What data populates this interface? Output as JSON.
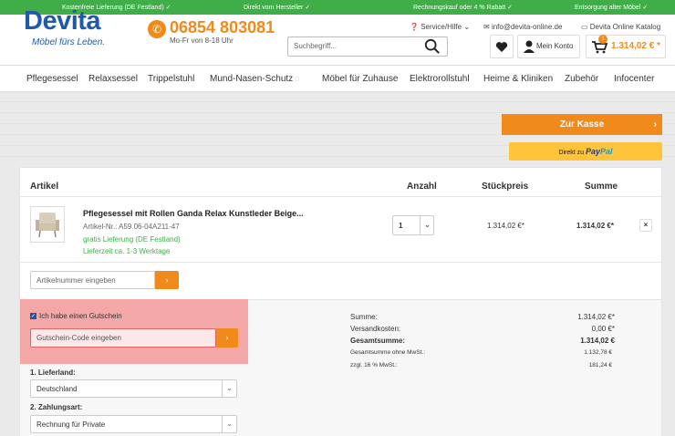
{
  "topbar": {
    "items": [
      "Kostenfreie Lieferung (DE Festland) ✓",
      "Direkt vom Hersteller ✓",
      "Rechnungskauf oder 4 % Rabatt ✓",
      "Entsorgung alter Möbel ✓"
    ]
  },
  "header": {
    "logo": "Devita",
    "tagline": "Möbel fürs Leben.",
    "phone": "06854 803081",
    "phone_hours": "Mo-Fr von 8-18 Uhr",
    "search_placeholder": "Suchbegriff...",
    "service": "Service/Hilfe",
    "email": "info@devita-online.de",
    "catalog": "Devita Online Katalog",
    "account": "Mein Konto",
    "cart_count": "1",
    "cart_amount": "1.314,02 € *"
  },
  "nav": {
    "items": [
      "Pflegesessel",
      "Relaxsessel",
      "Trippelstuhl",
      "Mund-Nasen-Schutz",
      "Möbel für Zuhause",
      "Elektrorollstuhl",
      "Heime & Kliniken",
      "Zubehör",
      "Infocenter"
    ]
  },
  "checkout": {
    "kasse_label": "Zur Kasse",
    "paypal_prefix": "Direkt zu",
    "paypal_brand_a": "Pay",
    "paypal_brand_b": "Pal"
  },
  "table": {
    "headers": {
      "article": "Artikel",
      "qty": "Anzahl",
      "unit": "Stückpreis",
      "total": "Summe"
    },
    "item": {
      "name": "Pflegesessel mit Rollen Ganda Relax Kunstleder Beige...",
      "artnr": "Artikel-Nr.: A59.06-04A211-47",
      "shipping": "gratis Lieferung (DE Festland)",
      "delivery": "Lieferzeit ca. 1-3 Werktage",
      "qty": "1",
      "unit_price": "1.314,02 €*",
      "total_price": "1.314,02 €*",
      "remove": "×"
    },
    "artnr_placeholder": "Artikelnummer eingeben"
  },
  "voucher": {
    "checkbox_label": "Ich habe einen Gutschein",
    "input_placeholder": "Gutschein-Code eingeben"
  },
  "selects": {
    "country_label": "1. Lieferland:",
    "country_value": "Deutschland",
    "payment_label": "2. Zahlungsart:",
    "payment_value": "Rechnung für Private"
  },
  "summary": {
    "rows": [
      {
        "label": "Summe:",
        "value": "1.314,02 €*"
      },
      {
        "label": "Versandkosten:",
        "value": "0,00 €*"
      },
      {
        "label": "Gesamtsumme:",
        "value": "1.314,02 €"
      },
      {
        "label": "Gesamtsumme ohne MwSt.:",
        "value": "1.132,78 €"
      },
      {
        "label": "zzgl. 16 % MwSt.:",
        "value": "181,24 €"
      }
    ]
  },
  "colors": {
    "brand_blue": "#1e5aa8",
    "accent_orange": "#f08a1a",
    "topbar_green": "#3fae49",
    "paypal_yellow": "#ffc439"
  }
}
